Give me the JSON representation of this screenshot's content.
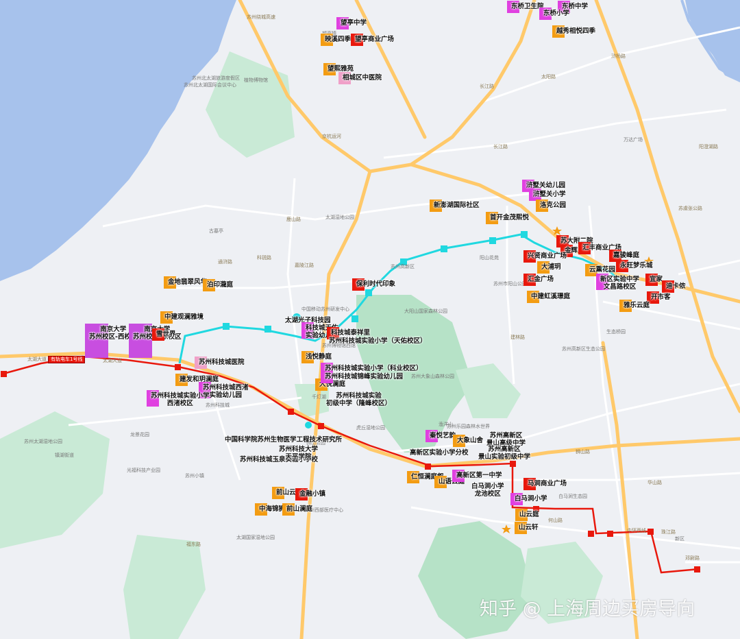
{
  "pois": [
    {
      "name": "poi-wangting-middle-school",
      "text": "望亭中学",
      "color": "magenta",
      "lines": 1
    },
    {
      "name": "poi-yingxi-siji",
      "text": "映溪四季",
      "color": "orange",
      "lines": 1
    },
    {
      "name": "poi-wangting-plaza",
      "text": "望亭商业广场",
      "color": "red",
      "lines": 1
    },
    {
      "name": "poi-wangxi-yayuan",
      "text": "望熙雅苑",
      "color": "orange",
      "lines": 1
    },
    {
      "name": "poi-xiangcheng-tcm",
      "text": "相城区中医院",
      "color": "pink",
      "lines": 1
    },
    {
      "name": "poi-dongqiao-health",
      "text": "东桥卫生院",
      "color": "magenta",
      "lines": 1
    },
    {
      "name": "poi-dongqiao-middle",
      "text": "东桥中学",
      "color": "magenta",
      "lines": 1
    },
    {
      "name": "poi-dongqiao-primary",
      "text": "东桥小学",
      "color": "magenta",
      "lines": 1
    },
    {
      "name": "poi-yuexiu-xiangyue",
      "text": "越秀相悦四季",
      "color": "orange",
      "lines": 1
    },
    {
      "name": "poi-hushuguan-kg",
      "text": "浒墅关幼儿园",
      "color": "magenta",
      "lines": 1
    },
    {
      "name": "poi-hushuguan-primary",
      "text": "浒墅关小学",
      "color": "magenta",
      "lines": 1
    },
    {
      "name": "poi-luoke-park",
      "text": "洛克公园",
      "color": "orange",
      "lines": 1
    },
    {
      "name": "poi-xinpenghu",
      "text": "新澎湖国际社区",
      "color": "orange",
      "lines": 1
    },
    {
      "name": "poi-shoukai-jinmao",
      "text": "首开金茂熙悦",
      "color": "orange",
      "lines": 1
    },
    {
      "name": "poi-sudafu-2",
      "text": "苏大附二院",
      "color": "red",
      "lines": 1
    },
    {
      "name": "poi-jinhuili",
      "text": "金辉里",
      "color": "red",
      "lines": 1
    },
    {
      "name": "poi-huifeng-plaza",
      "text": "汇丰商业广场",
      "color": "red",
      "lines": 1
    },
    {
      "name": "poi-jiajun-fengting",
      "text": "嘉骏峰庭",
      "color": "red",
      "lines": 1
    },
    {
      "name": "poi-xingxian-plaza",
      "text": "兴贤商业广场",
      "color": "red",
      "lines": 1
    },
    {
      "name": "poi-dapuyu",
      "text": "大浦玥",
      "color": "orange",
      "lines": 1
    },
    {
      "name": "poi-yunxun-garden",
      "text": "云熏花园",
      "color": "orange",
      "lines": 1
    },
    {
      "name": "poi-yongwang-mengle",
      "text": "永旺梦乐城",
      "color": "red",
      "lines": 1
    },
    {
      "name": "poi-huijin-plaza",
      "text": "汇金广场",
      "color": "red",
      "lines": 1
    },
    {
      "name": "poi-xinqu-exp-middle",
      "text": "新区实验中学\n文昌路校区",
      "color": "magenta",
      "lines": 2
    },
    {
      "name": "poi-yijia",
      "text": "宜家",
      "color": "red",
      "lines": 1
    },
    {
      "name": "poi-dikanong",
      "text": "迪卡侬",
      "color": "red",
      "lines": 1
    },
    {
      "name": "poi-kaisamei",
      "text": "开市客",
      "color": "red",
      "lines": 1
    },
    {
      "name": "poi-zhongjian-hongxi",
      "text": "中建虹溪璟庭",
      "color": "orange",
      "lines": 1
    },
    {
      "name": "poi-yale-yunting",
      "text": "雅乐云庭",
      "color": "orange",
      "lines": 1
    },
    {
      "name": "poi-nju-west",
      "text": "南京大学\n苏州校区-西校区",
      "color": "purple",
      "lines": 2
    },
    {
      "name": "poi-nju-east",
      "text": "南京大学\n苏州校区-东校区",
      "color": "purple",
      "lines": 2
    },
    {
      "name": "poi-xueshijie",
      "text": "雪世界",
      "color": "red",
      "lines": 1
    },
    {
      "name": "poi-jianfa-xiangyue",
      "text": "建发和玥澜庭",
      "color": "orange",
      "lines": 1
    },
    {
      "name": "poi-kechuang-xiqing-kg",
      "text": "苏州科技城西渚\n实验幼儿园",
      "color": "magenta",
      "lines": 2
    },
    {
      "name": "poi-kechuang-exp-primary",
      "text": "苏州科技城实验小学\n西渚校区",
      "color": "magenta",
      "lines": 2
    },
    {
      "name": "poi-kechuang-hospital",
      "text": "苏州科技城医院",
      "color": "pink",
      "lines": 1
    },
    {
      "name": "poi-jinshan-fengting",
      "text": "金地翡翠风华",
      "color": "orange",
      "lines": 1
    },
    {
      "name": "poi-borun-fuyue",
      "text": "泊印瀧庭",
      "color": "orange",
      "lines": 1
    },
    {
      "name": "poi-qinghai-qinghe",
      "text": "中建观澜雅境",
      "color": "orange",
      "lines": 1
    },
    {
      "name": "poi-taihu-guangzi",
      "text": "太湖光子科技园",
      "color": "none",
      "lines": 1
    },
    {
      "name": "poi-kejicheng-tianyuan",
      "text": "科技城天佑\n实验幼儿园",
      "color": "magenta",
      "lines": 2
    },
    {
      "name": "poi-kejicheng-huashi",
      "text": "科技城泰祥里",
      "color": "red",
      "lines": 1
    },
    {
      "name": "poi-kejicheng-primary-tc",
      "text": "苏州科技城实验小学（天佑校区）",
      "color": "none",
      "lines": 1
    },
    {
      "name": "poi-baoli-shiji",
      "text": "保利时代印象",
      "color": "red",
      "lines": 1
    },
    {
      "name": "poi-longyue",
      "text": "浅悦静庭",
      "color": "orange",
      "lines": 1
    },
    {
      "name": "poi-dayue-lanting",
      "text": "大悦澜庭",
      "color": "orange",
      "lines": 1
    },
    {
      "name": "poi-kejicheng-exp-primary-ky",
      "text": "苏州科技城实验小学（科业校区）",
      "color": "magenta",
      "lines": 1
    },
    {
      "name": "poi-kejicheng-jinfeng-kg",
      "text": "苏州科技城锦峰实验幼儿园",
      "color": "magenta",
      "lines": 1
    },
    {
      "name": "poi-kejicheng-exp-middle",
      "text": "苏州科技城实验\n初级中学（隆峰校区）",
      "color": "none",
      "lines": 2
    },
    {
      "name": "poi-qintai-guoxue",
      "text": "秦悦艺韵",
      "color": "magenta",
      "lines": 1
    },
    {
      "name": "poi-dashan-shanshe",
      "text": "大象山舍",
      "color": "orange",
      "lines": 1
    },
    {
      "name": "poi-gaoxin-jingshan-middle",
      "text": "苏州高新区\n景山高级中学",
      "color": "none",
      "lines": 2
    },
    {
      "name": "poi-gaoxin-jingshan-junior",
      "text": "苏州高新区\n景山实验初级中学",
      "color": "none",
      "lines": 2
    },
    {
      "name": "poi-gaoxin-exp-primary",
      "text": "高新区实验小学分校",
      "color": "none",
      "lines": 1
    },
    {
      "name": "poi-renheng-lanting",
      "text": "仁恒澜庭叙",
      "color": "orange",
      "lines": 1
    },
    {
      "name": "poi-shanhu-yunting",
      "text": "山语云庭",
      "color": "orange",
      "lines": 1
    },
    {
      "name": "poi-gaoxin-no1-middle",
      "text": "高新区第一中学",
      "color": "magenta",
      "lines": 1
    },
    {
      "name": "poi-baima-primary-longchi",
      "text": "白马涧小学\n龙池校区",
      "color": "none",
      "lines": 2
    },
    {
      "name": "poi-mashan-plaza",
      "text": "马涧商业广场",
      "color": "red",
      "lines": 1
    },
    {
      "name": "poi-baima-primary",
      "text": "白马涧小学",
      "color": "magenta",
      "lines": 1
    },
    {
      "name": "poi-shanyun-ting",
      "text": "山云庭",
      "color": "orange",
      "lines": 1
    },
    {
      "name": "poi-shanyun-xuan",
      "text": "山云轩",
      "color": "orange",
      "lines": 1
    },
    {
      "name": "poi-qianshan-yunting",
      "text": "前山云庭",
      "color": "orange",
      "lines": 1
    },
    {
      "name": "poi-jinrun-xiaozhen",
      "text": "金融小镇",
      "color": "red",
      "lines": 1
    },
    {
      "name": "poi-zhonghai-jinshan",
      "text": "中海锦狮山",
      "color": "orange",
      "lines": 1
    },
    {
      "name": "poi-qianshan-yuan",
      "text": "前山澜庭",
      "color": "orange",
      "lines": 1
    },
    {
      "name": "poi-kechuang-yuquan",
      "text": "苏州科技城玉泉实验小学校",
      "color": "none",
      "lines": 1
    },
    {
      "name": "poi-cas-research",
      "text": "中国科学院苏州生物医学工程技术研究所",
      "color": "none",
      "lines": 1
    },
    {
      "name": "poi-sufu-sanwei",
      "text": "苏州科技大学\n天平学院",
      "color": "none",
      "lines": 2
    }
  ],
  "place_labels": [
    "苏州北太湖旅游度假区",
    "植物博物馆",
    "苏州北太湖国际会议中心",
    "古墓亭",
    "太湖湿地公园",
    "中国移动苏州研发中心",
    "苏州高新区",
    "阳山花苑",
    "苏州市阳山公园",
    "大阳山国家森林公园",
    "苏州乐园森林水世界",
    "苏州大象山森林公园",
    "狮山公园",
    "生态桥园",
    "苏州太湖湿地公园",
    "太湖国家湿地公园",
    "千灯湖",
    "渔洋山",
    "白马涧生态园",
    "镇湖街道",
    "光福科技产业园",
    "苏州西部医疗中心",
    "苏州科技城",
    "苏州博物馆西馆",
    "苏州小镇",
    "龙景花园",
    "万达广场",
    "望亭镇",
    "新区",
    "苏州高新区生态公园",
    "虎丘湿地公园"
  ],
  "road_labels": [
    "太湖大道",
    "长江路",
    "太阳路",
    "华山路",
    "狮山路",
    "长江路",
    "通浒路",
    "京杭运河",
    "苏州绕城高速",
    "阳澄湖路",
    "苏虞张公路",
    "鹿山路",
    "嘉陵江路",
    "太湖大道",
    "珠江路",
    "邓尉路",
    "福东路",
    "科锐路",
    "浒杨路",
    "建林路",
    "中环西线",
    "何山路"
  ],
  "tram_label": "有轨电车1号线",
  "watermark": "知乎 @ 上海周边买房导向",
  "colors": {
    "water": "#a7c2ec",
    "park": "#b6e2c7",
    "road_major": "#ffc96a",
    "route_red": "#e8180c",
    "route_cyan": "#20d8e0"
  }
}
